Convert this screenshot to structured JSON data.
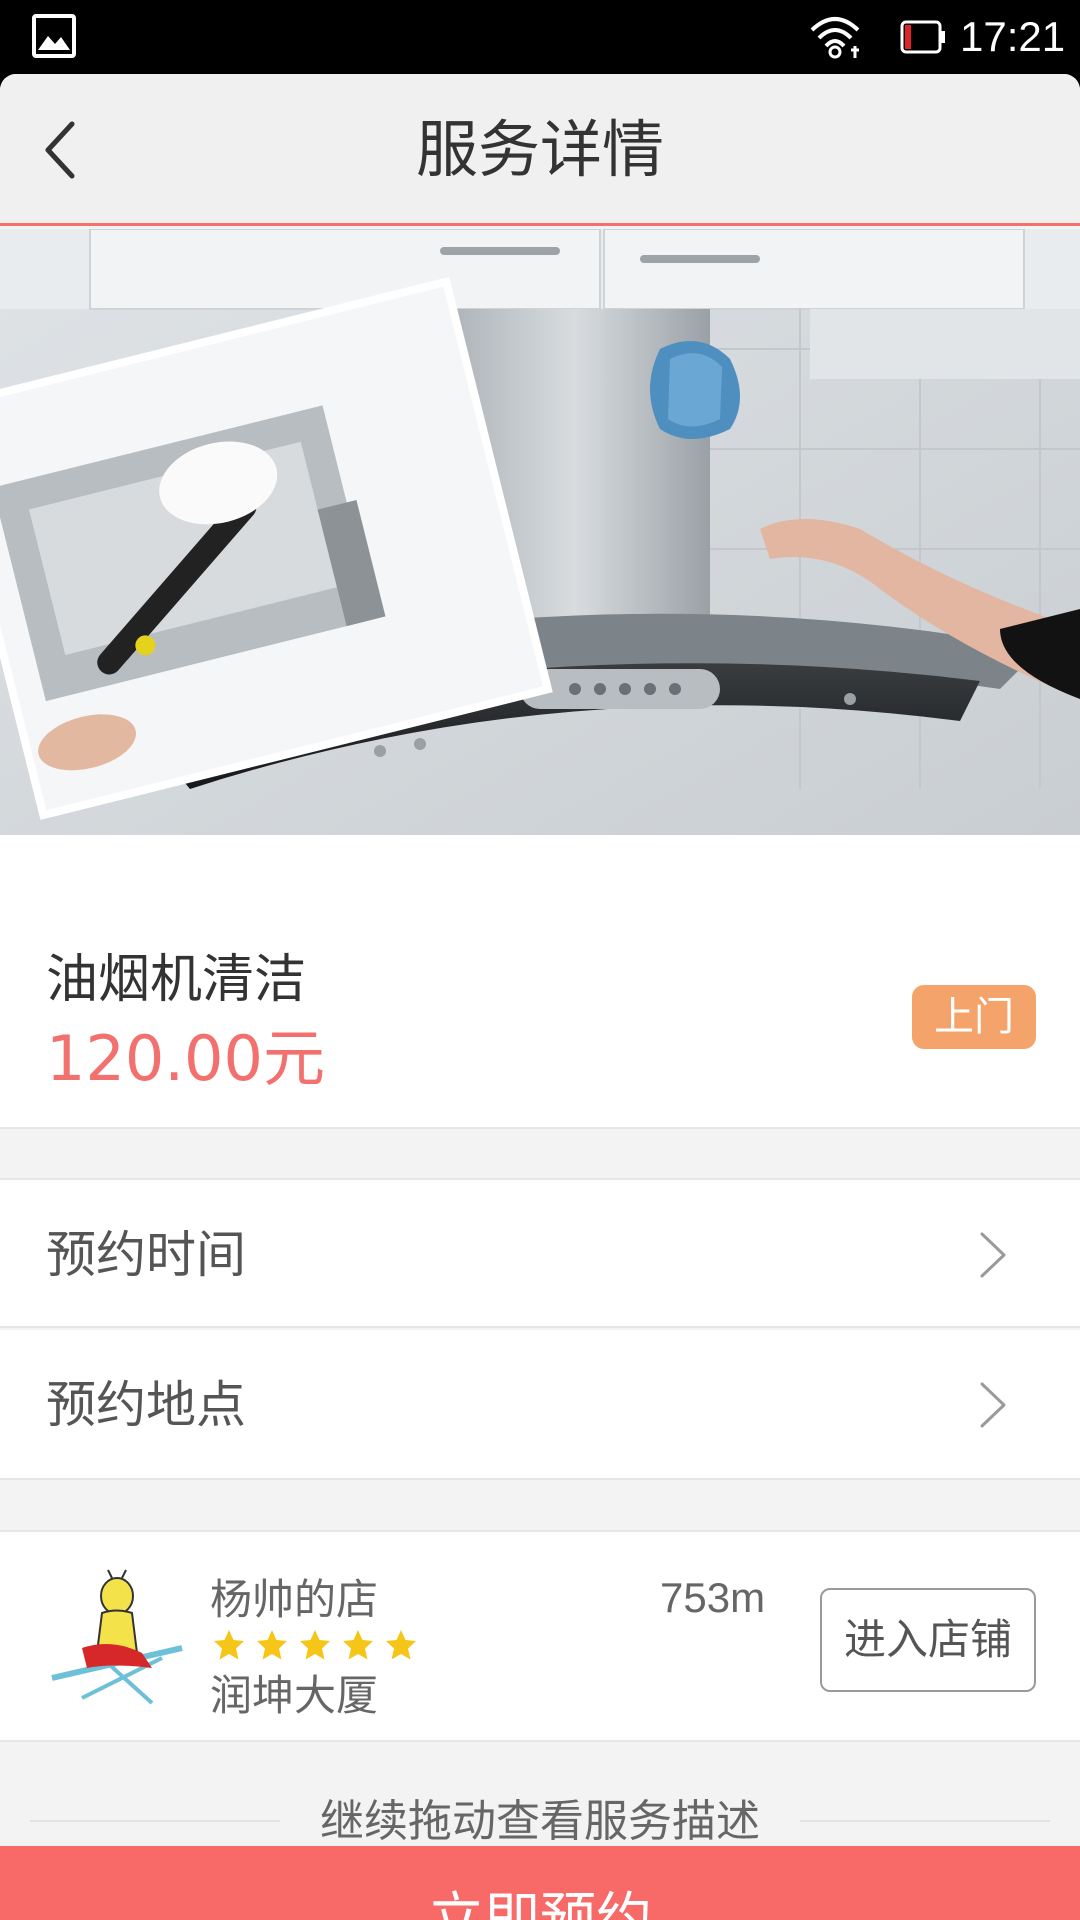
{
  "status_bar": {
    "time": "17:21",
    "icons": [
      "gallery-icon",
      "wifi-icon",
      "battery-low-icon"
    ]
  },
  "header": {
    "title": "服务详情",
    "back_icon": "chevron-left-icon"
  },
  "product": {
    "name": "油烟机清洁",
    "price": "120.00元",
    "badge": "上门"
  },
  "booking": {
    "time_label": "预约时间",
    "place_label": "预约地点",
    "chevron_icon": "chevron-right-icon"
  },
  "shop": {
    "name": "杨帅的店",
    "distance": "753m",
    "rating": 5,
    "rating_max": 5,
    "address": "润坤大厦",
    "enter_label": "进入店铺"
  },
  "hint": "继续拖动查看服务描述",
  "cta": "立即预约",
  "colors": {
    "accent": "#f86a68",
    "price": "#f2706d",
    "badge": "#f4a46a",
    "star": "#f5c518"
  }
}
